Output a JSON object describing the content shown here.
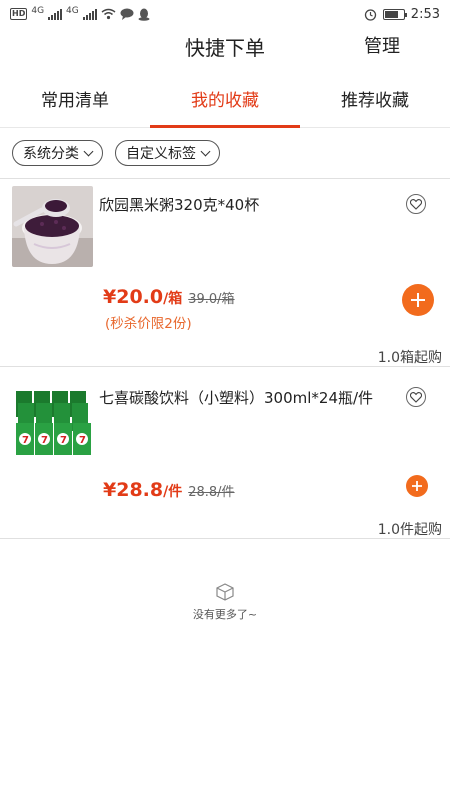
{
  "status_bar": {
    "left_label": "HD",
    "net1": "4G",
    "net2": "4G",
    "time": "2:53",
    "battery_level": 0.75,
    "icons": [
      "signal-icon",
      "wifi-icon",
      "message-icon",
      "qq-icon",
      "alarm-icon",
      "battery-icon"
    ]
  },
  "header": {
    "title": "快捷下单",
    "manage": "管理"
  },
  "tabs": [
    {
      "label": "常用清单",
      "active": false
    },
    {
      "label": "我的收藏",
      "active": true
    },
    {
      "label": "推荐收藏",
      "active": false
    }
  ],
  "filters": [
    {
      "label": "系统分类"
    },
    {
      "label": "自定义标签"
    }
  ],
  "products": [
    {
      "name": "欣园黑米粥320克*40杯",
      "price": "¥20.0",
      "unit": "/箱",
      "original_price": "39.0/箱",
      "promo": "(秒杀价限2份)",
      "min_qty": "1.0箱起购",
      "image": "black-rice-porridge"
    },
    {
      "name": "七喜碳酸饮料（小塑料）300ml*24瓶/件",
      "price": "¥28.8",
      "unit": "/件",
      "original_price": "28.8/件",
      "promo": "",
      "min_qty": "1.0件起购",
      "image": "7up-cans"
    }
  ],
  "footer": {
    "no_more": "没有更多了~",
    "icon": "empty-box-icon"
  },
  "colors": {
    "accent": "#e23b17",
    "add_button": "#f26b1d"
  }
}
